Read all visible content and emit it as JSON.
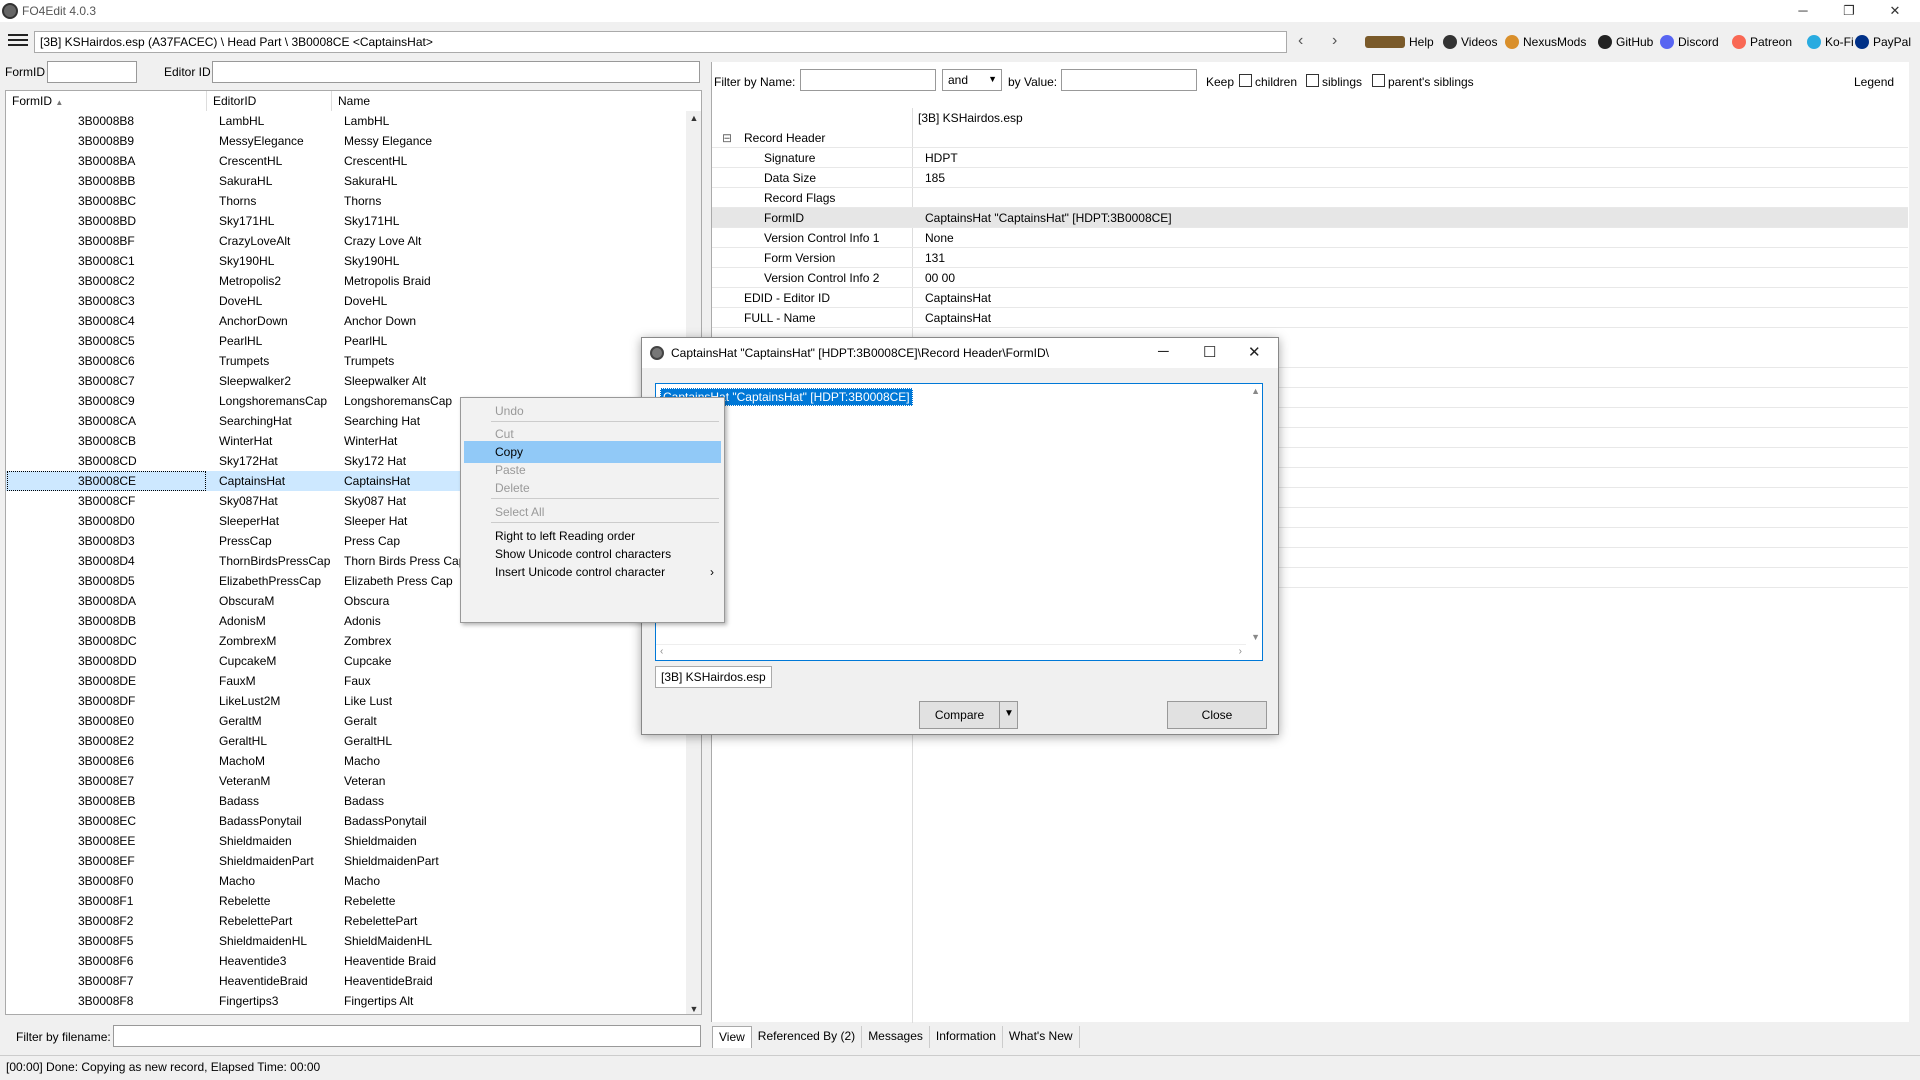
{
  "window": {
    "title": "FO4Edit 4.0.3",
    "controls": {
      "minimize": "─",
      "restore": "❐",
      "close": "✕"
    }
  },
  "toolbar": {
    "path": "[3B] KSHairdos.esp (A37FACEC) \\ Head Part \\ 3B0008CE <CaptainsHat>",
    "back": "‹",
    "forward": "›",
    "links": [
      {
        "label": "Help",
        "color": "#7a5a2a",
        "icon": "book-icon"
      },
      {
        "label": "Videos",
        "color": "#333333",
        "icon": "video-icon"
      },
      {
        "label": "NexusMods",
        "color": "#d98f2b",
        "icon": "nexus-icon"
      },
      {
        "label": "GitHub",
        "color": "#222222",
        "icon": "github-icon"
      },
      {
        "label": "Discord",
        "color": "#5865f2",
        "icon": "discord-icon"
      },
      {
        "label": "Patreon",
        "color": "#f96854",
        "icon": "patreon-icon"
      },
      {
        "label": "Ko-Fi",
        "color": "#29abe0",
        "icon": "kofi-icon"
      },
      {
        "label": "PayPal",
        "color": "#003087",
        "icon": "paypal-icon"
      }
    ]
  },
  "left": {
    "formid_label": "FormID",
    "editorid_label": "Editor ID",
    "columns": [
      "FormID",
      "EditorID",
      "Name"
    ],
    "sort_indicator": "▲",
    "rows": [
      [
        "3B0008B8",
        "LambHL",
        "LambHL"
      ],
      [
        "3B0008B9",
        "MessyElegance",
        "Messy Elegance"
      ],
      [
        "3B0008BA",
        "CrescentHL",
        "CrescentHL"
      ],
      [
        "3B0008BB",
        "SakuraHL",
        "SakuraHL"
      ],
      [
        "3B0008BC",
        "Thorns",
        "Thorns"
      ],
      [
        "3B0008BD",
        "Sky171HL",
        "Sky171HL"
      ],
      [
        "3B0008BF",
        "CrazyLoveAlt",
        "Crazy Love Alt"
      ],
      [
        "3B0008C1",
        "Sky190HL",
        "Sky190HL"
      ],
      [
        "3B0008C2",
        "Metropolis2",
        "Metropolis Braid"
      ],
      [
        "3B0008C3",
        "DoveHL",
        "DoveHL"
      ],
      [
        "3B0008C4",
        "AnchorDown",
        "Anchor Down"
      ],
      [
        "3B0008C5",
        "PearlHL",
        "PearlHL"
      ],
      [
        "3B0008C6",
        "Trumpets",
        "Trumpets"
      ],
      [
        "3B0008C7",
        "Sleepwalker2",
        "Sleepwalker Alt"
      ],
      [
        "3B0008C9",
        "LongshoremansCap",
        "LongshoremansCap"
      ],
      [
        "3B0008CA",
        "SearchingHat",
        "Searching Hat"
      ],
      [
        "3B0008CB",
        "WinterHat",
        "WinterHat"
      ],
      [
        "3B0008CD",
        "Sky172Hat",
        "Sky172 Hat"
      ],
      [
        "3B0008CE",
        "CaptainsHat",
        "CaptainsHat"
      ],
      [
        "3B0008CF",
        "Sky087Hat",
        "Sky087 Hat"
      ],
      [
        "3B0008D0",
        "SleeperHat",
        "Sleeper Hat"
      ],
      [
        "3B0008D3",
        "PressCap",
        "Press Cap"
      ],
      [
        "3B0008D4",
        "ThornBirdsPressCap",
        "Thorn Birds Press Cap"
      ],
      [
        "3B0008D5",
        "ElizabethPressCap",
        "Elizabeth Press Cap"
      ],
      [
        "3B0008DA",
        "ObscuraM",
        "Obscura"
      ],
      [
        "3B0008DB",
        "AdonisM",
        "Adonis"
      ],
      [
        "3B0008DC",
        "ZombrexM",
        "Zombrex"
      ],
      [
        "3B0008DD",
        "CupcakeM",
        "Cupcake"
      ],
      [
        "3B0008DE",
        "FauxM",
        "Faux"
      ],
      [
        "3B0008DF",
        "LikeLust2M",
        "Like Lust"
      ],
      [
        "3B0008E0",
        "GeraltM",
        "Geralt"
      ],
      [
        "3B0008E2",
        "GeraltHL",
        "GeraltHL"
      ],
      [
        "3B0008E6",
        "MachoM",
        "Macho"
      ],
      [
        "3B0008E7",
        "VeteranM",
        "Veteran"
      ],
      [
        "3B0008EB",
        "Badass",
        "Badass"
      ],
      [
        "3B0008EC",
        "BadassPonytail",
        "BadassPonytail"
      ],
      [
        "3B0008EE",
        "Shieldmaiden",
        "Shieldmaiden"
      ],
      [
        "3B0008EF",
        "ShieldmaidenPart",
        "ShieldmaidenPart"
      ],
      [
        "3B0008F0",
        "Macho",
        "Macho"
      ],
      [
        "3B0008F1",
        "Rebelette",
        "Rebelette"
      ],
      [
        "3B0008F2",
        "RebelettePart",
        "RebelettePart"
      ],
      [
        "3B0008F5",
        "ShieldmaidenHL",
        "ShieldMaidenHL"
      ],
      [
        "3B0008F6",
        "Heaventide3",
        "Heaventide Braid"
      ],
      [
        "3B0008F7",
        "HeaventideBraid",
        "HeaventideBraid"
      ],
      [
        "3B0008F8",
        "Fingertips3",
        "Fingertips Alt"
      ]
    ],
    "selected_index": 18,
    "file_filter_label": "Filter by filename:"
  },
  "right": {
    "filter_name_label": "Filter by Name:",
    "and_value": "and",
    "filter_value_label": "by Value:",
    "keep_label": "Keep",
    "children_label": "children",
    "siblings_label": "siblings",
    "parents_siblings_label": "parent's siblings",
    "legend_label": "Legend",
    "file_header": "[3B] KSHairdos.esp",
    "records": [
      {
        "key": "Record Header",
        "value": "",
        "indent": 0,
        "expander": "⊟"
      },
      {
        "key": "Signature",
        "value": "HDPT",
        "indent": 1
      },
      {
        "key": "Data Size",
        "value": "185",
        "indent": 1
      },
      {
        "key": "Record Flags",
        "value": "",
        "indent": 1
      },
      {
        "key": "FormID",
        "value": "CaptainsHat \"CaptainsHat\" [HDPT:3B0008CE]",
        "indent": 1,
        "highlight": true
      },
      {
        "key": "Version Control Info 1",
        "value": "None",
        "indent": 1
      },
      {
        "key": "Form Version",
        "value": "131",
        "indent": 1
      },
      {
        "key": "Version Control Info 2",
        "value": "00 00",
        "indent": 1
      },
      {
        "key": "EDID - Editor ID",
        "value": "CaptainsHat",
        "indent": 0
      },
      {
        "key": "FULL - Name",
        "value": "CaptainsHat",
        "indent": 0
      }
    ],
    "tabs": [
      "View",
      "Referenced By (2)",
      "Messages",
      "Information",
      "What's New"
    ]
  },
  "dialog": {
    "title": "CaptainsHat \"CaptainsHat\" [HDPT:3B0008CE]\\Record Header\\FormID\\",
    "text": "CaptainsHat \"CaptainsHat\" [HDPT:3B0008CE]",
    "tab": "[3B] KSHairdos.esp",
    "compare_label": "Compare",
    "close_label": "Close",
    "controls": {
      "minimize": "─",
      "maximize": "☐",
      "close": "✕"
    }
  },
  "context_menu": {
    "items": [
      {
        "label": "Undo",
        "enabled": false
      },
      {
        "label": "Cut",
        "enabled": false
      },
      {
        "label": "Copy",
        "enabled": true,
        "hover": true
      },
      {
        "label": "Paste",
        "enabled": false
      },
      {
        "label": "Delete",
        "enabled": false
      },
      {
        "label": "Select All",
        "enabled": false
      },
      {
        "label": "Right to left Reading order",
        "enabled": true
      },
      {
        "label": "Show Unicode control characters",
        "enabled": true
      },
      {
        "label": "Insert Unicode control character",
        "enabled": true,
        "submenu": "›"
      }
    ]
  },
  "status": {
    "text": "[00:00] Done: Copying as new record, Elapsed Time: 00:00"
  }
}
